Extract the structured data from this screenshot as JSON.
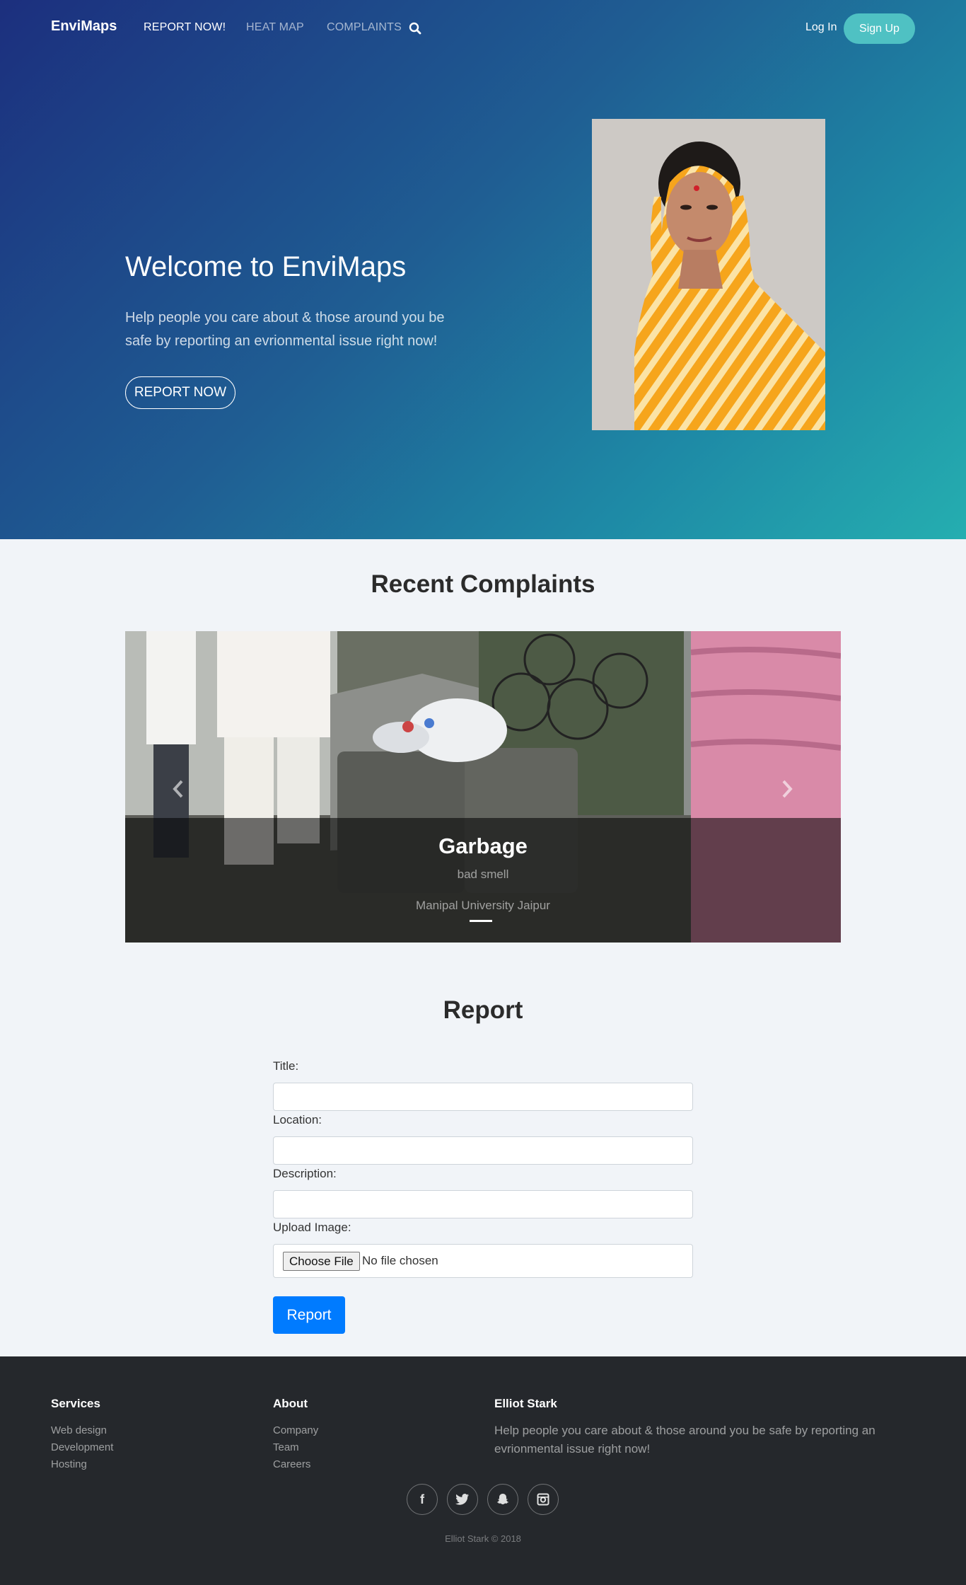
{
  "nav": {
    "brand": "EnviMaps",
    "links": [
      {
        "label": "REPORT NOW!",
        "active": true
      },
      {
        "label": "HEAT MAP",
        "active": false
      },
      {
        "label": "COMPLAINTS",
        "active": false
      }
    ],
    "search_icon": "search-icon",
    "login": "Log In",
    "signup": "Sign Up"
  },
  "hero": {
    "title": "Welcome to EnviMaps",
    "subtitle": "Help people you care about & those around you be safe by reporting an evrionmental issue right now!",
    "button": "REPORT NOW"
  },
  "recent": {
    "title": "Recent Complaints",
    "slide": {
      "title": "Garbage",
      "description": "bad smell",
      "location": "Manipal University Jaipur"
    },
    "prev_icon": "chevron-left-icon",
    "next_icon": "chevron-right-icon"
  },
  "report": {
    "title": "Report",
    "fields": [
      {
        "label": "Title:",
        "value": ""
      },
      {
        "label": "Location:",
        "value": ""
      },
      {
        "label": "Description:",
        "value": ""
      }
    ],
    "upload_label": "Upload Image:",
    "choose_file": "Choose File",
    "no_file": "No file chosen",
    "submit": "Report"
  },
  "footer": {
    "services_title": "Services",
    "services": [
      "Web design",
      "Development",
      "Hosting"
    ],
    "about_title": "About",
    "about": [
      "Company",
      "Team",
      "Careers"
    ],
    "contact_title": "Elliot Stark",
    "contact_text": "Help people you care about & those around you be safe by reporting an evrionmental issue right now!",
    "socials": [
      "facebook-icon",
      "twitter-icon",
      "snapchat-icon",
      "instagram-icon"
    ],
    "copyright": "Elliot Stark © 2018"
  },
  "colors": {
    "accent": "#007bff",
    "signup": "#4fc1c3",
    "footer_bg": "#25282c",
    "page_bg": "#f1f4f8"
  }
}
